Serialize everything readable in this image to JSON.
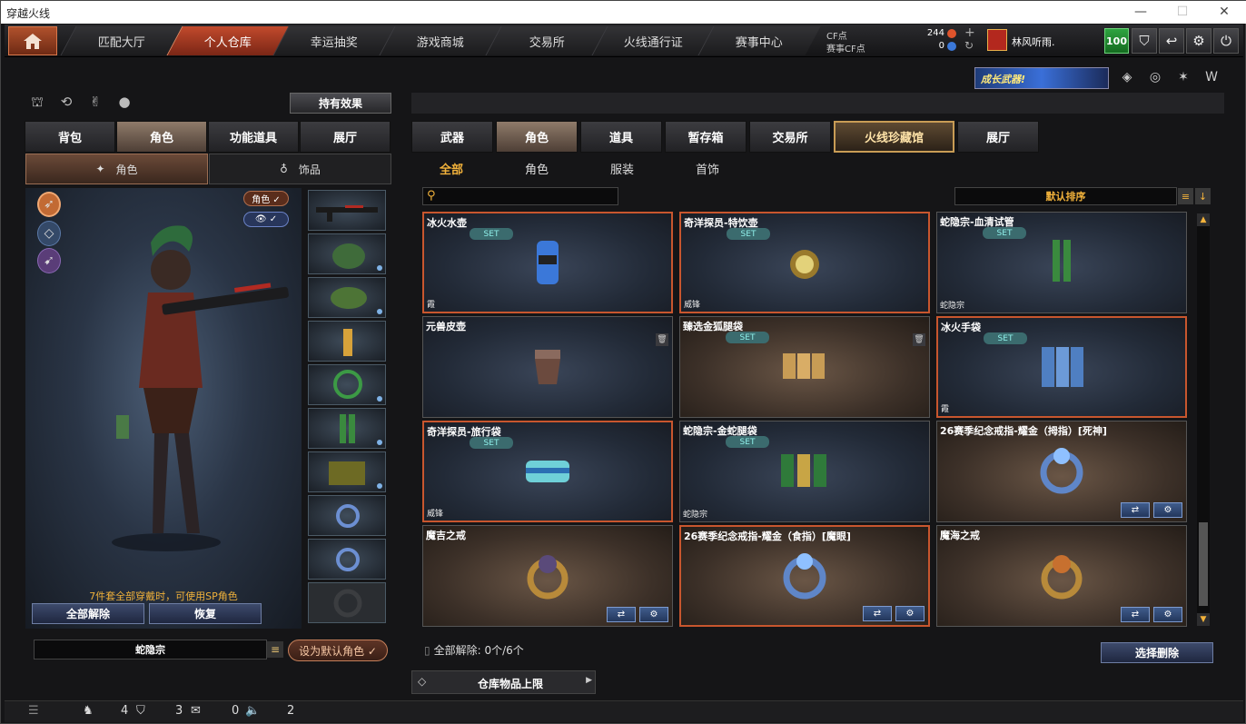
{
  "window": {
    "title": "穿越火线"
  },
  "nav": {
    "tabs": [
      "匹配大厅",
      "个人仓库",
      "幸运抽奖",
      "游戏商城",
      "交易所",
      "火线通行证",
      "赛事中心"
    ],
    "active": "个人仓库"
  },
  "currency": {
    "cf_label": "CF点",
    "cf_value": "244",
    "event_label": "赛事CF点",
    "event_value": "0"
  },
  "user": {
    "name": "林风听雨.",
    "level": "100"
  },
  "banner": {
    "text": "成长武器!"
  },
  "left": {
    "effect_button": "持有效果",
    "tabs": [
      "背包",
      "角色",
      "功能道具",
      "展厅"
    ],
    "subtabs": [
      "角色",
      "饰品"
    ],
    "badge_role": "角色 ✓",
    "hint": "7件套全部穿戴时，可使用SP角色",
    "unequip_all": "全部解除",
    "restore": "恢复",
    "character_name": "蛇隐宗",
    "set_default": "设为默认角色 ✓"
  },
  "right": {
    "tabs": [
      "武器",
      "角色",
      "道具",
      "暂存箱",
      "交易所",
      "火线珍藏馆",
      "展厅"
    ],
    "subtabs": [
      "全部",
      "角色",
      "服装",
      "首饰"
    ],
    "sort_label": "默认排序",
    "items": [
      {
        "name": "冰火水壶",
        "set": "SET",
        "tag": "霞",
        "style": "cool",
        "sel": true
      },
      {
        "name": "奇洋探员-特饮壶",
        "set": "SET",
        "tag": "威锋",
        "style": "cool",
        "sel": true
      },
      {
        "name": "蛇隐宗-血清试管",
        "set": "SET",
        "tag": "蛇隐宗",
        "style": "cool",
        "sel": false
      },
      {
        "name": "元兽皮壶",
        "set": "",
        "tag": "",
        "style": "cool",
        "sel": false,
        "trash": true
      },
      {
        "name": "臻选金狐腿袋",
        "set": "SET",
        "tag": "",
        "style": "warm",
        "sel": false,
        "trash": true
      },
      {
        "name": "冰火手袋",
        "set": "SET",
        "tag": "霞",
        "style": "cool",
        "sel": true
      },
      {
        "name": "奇洋探员-旅行袋",
        "set": "SET",
        "tag": "威锋",
        "style": "cool",
        "sel": true
      },
      {
        "name": "蛇隐宗-金蛇腿袋",
        "set": "SET",
        "tag": "蛇隐宗",
        "style": "cool",
        "sel": false
      },
      {
        "name": "26赛季纪念戒指-耀金（拇指）[死神]",
        "set": "",
        "tag": "",
        "style": "warm",
        "sel": false,
        "acts": true
      },
      {
        "name": "魔吉之戒",
        "set": "",
        "tag": "",
        "style": "warm",
        "sel": false,
        "acts": true
      },
      {
        "name": "26赛季纪念戒指-耀金（食指）[魔眼]",
        "set": "",
        "tag": "",
        "style": "warm",
        "sel": true,
        "acts": true
      },
      {
        "name": "魔海之戒",
        "set": "",
        "tag": "",
        "style": "warm",
        "sel": false,
        "acts": true
      }
    ],
    "unequip_status": "全部解除: 0个/6个",
    "delete_button": "选择删除",
    "capacity": "仓库物品上限"
  },
  "status": {
    "a": "4",
    "b": "3",
    "c": "0",
    "d": "2"
  },
  "colors": {
    "accent": "#c8562e",
    "gold": "#f2b23b",
    "set_text": "#8ff0ea"
  }
}
